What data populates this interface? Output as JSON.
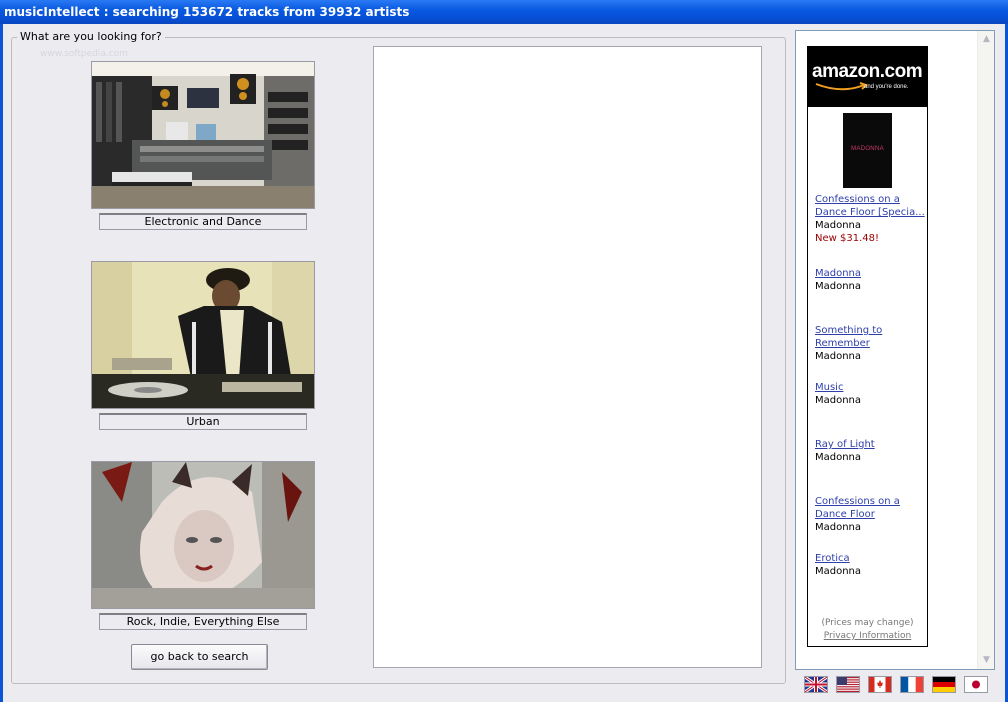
{
  "window": {
    "title": "musicIntellect : searching 153672 tracks from 39932 artists"
  },
  "group": {
    "legend": "What are you looking for?",
    "watermark": "www.softpedia.com"
  },
  "genres": [
    {
      "label": "Electronic and Dance"
    },
    {
      "label": "Urban"
    },
    {
      "label": "Rock, Indie, Everything Else"
    }
  ],
  "back_button": {
    "label": "go back to search"
  },
  "ad": {
    "brand": "amazon.com",
    "tagline": "and you're done.",
    "cover_text": "MADONNA",
    "items": [
      {
        "title_line1": "Confessions on a",
        "title_line2": "Dance Floor [Specia...",
        "artist": "Madonna",
        "price": "New $31.48!"
      },
      {
        "title_line1": "Madonna",
        "artist": "Madonna"
      },
      {
        "title_line1": "Something to",
        "title_line2": "Remember",
        "artist": "Madonna"
      },
      {
        "title_line1": "Music",
        "artist": "Madonna"
      },
      {
        "title_line1": "Ray of Light",
        "artist": "Madonna"
      },
      {
        "title_line1": "Confessions on a",
        "title_line2": "Dance Floor",
        "artist": "Madonna"
      },
      {
        "title_line1": "Erotica",
        "artist": "Madonna"
      }
    ],
    "prices_note": "(Prices may change)",
    "privacy_link": "Privacy Information"
  },
  "flags": [
    "uk-flag-icon",
    "us-flag-icon",
    "canada-flag-icon",
    "france-flag-icon",
    "germany-flag-icon",
    "japan-flag-icon"
  ],
  "colors": {
    "titlebar": "#0a5ae0",
    "window_bg": "#ecebf0",
    "link": "#2f3faa",
    "price": "#9a0000"
  }
}
